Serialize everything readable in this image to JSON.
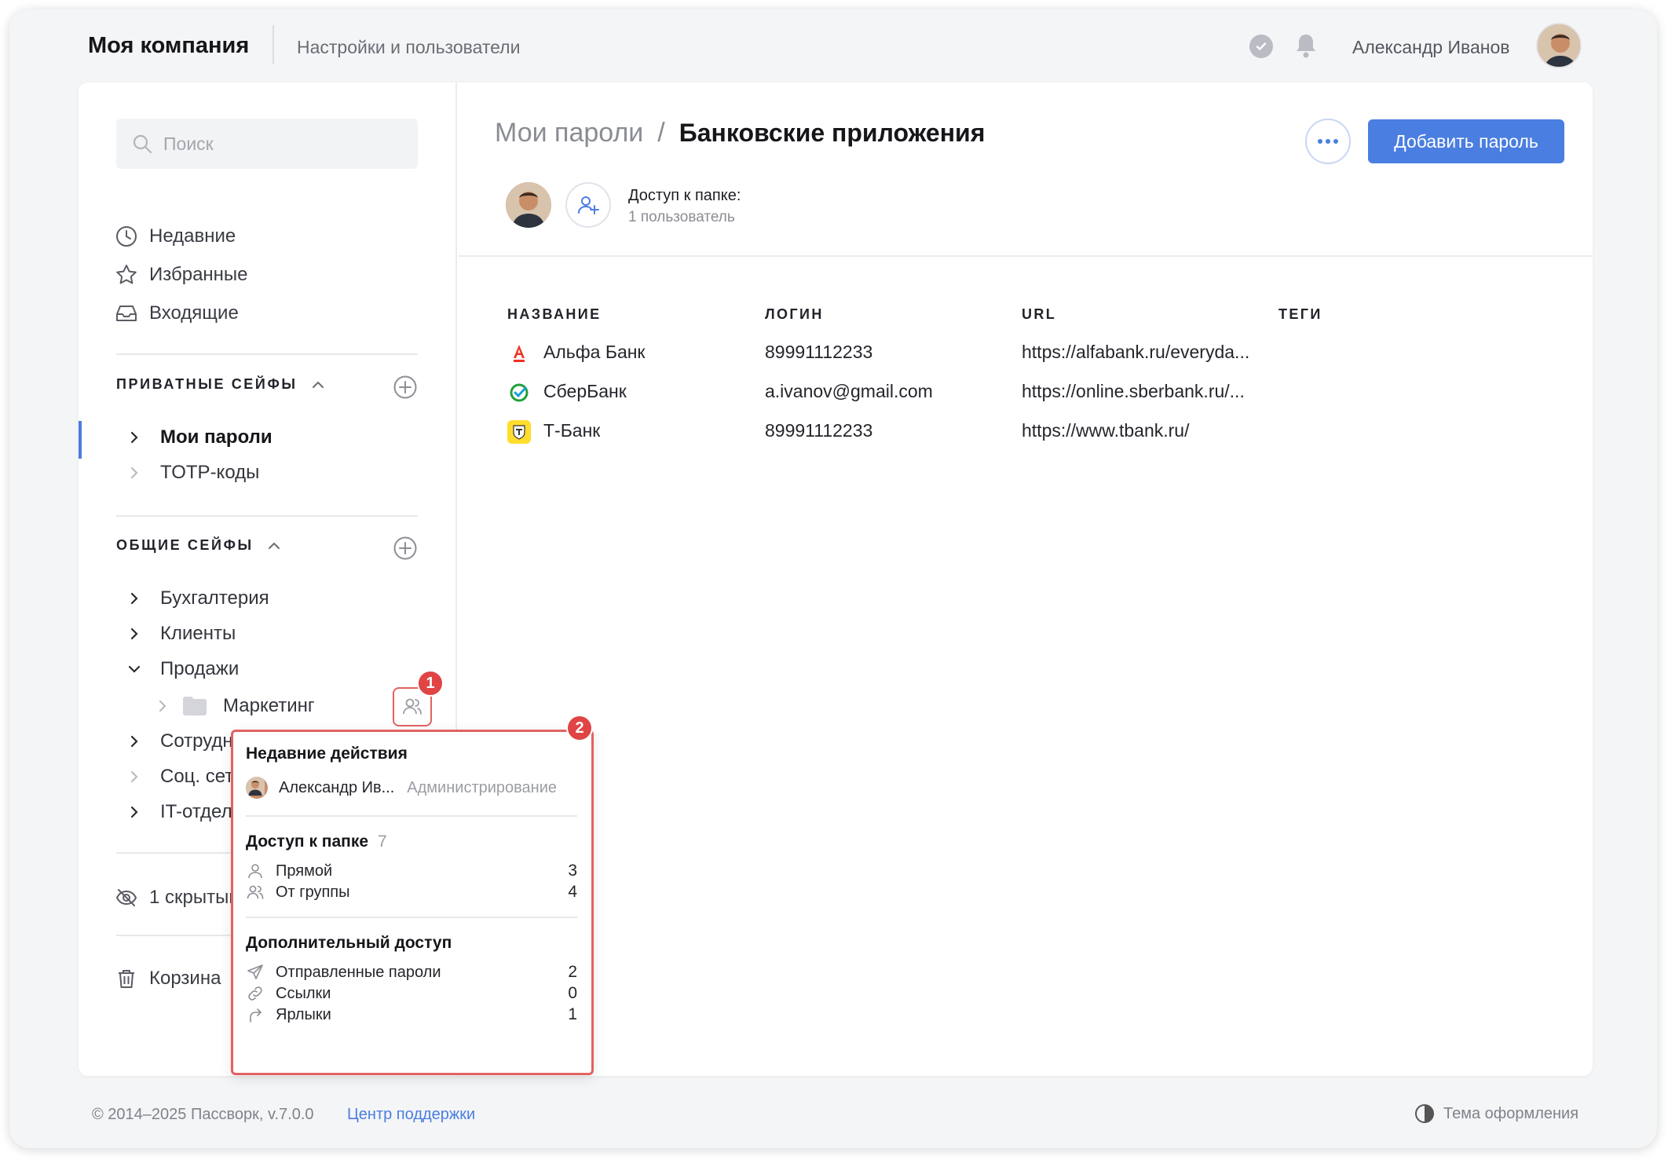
{
  "header": {
    "company": "Моя компания",
    "section": "Настройки и пользователи",
    "user_name": "Александр Иванов"
  },
  "sidebar": {
    "search_placeholder": "Поиск",
    "nav": [
      {
        "label": "Недавние",
        "icon": "clock-icon"
      },
      {
        "label": "Избранные",
        "icon": "star-icon"
      },
      {
        "label": "Входящие",
        "icon": "inbox-icon"
      }
    ],
    "private_vaults": {
      "title": "ПРИВАТНЫЕ СЕЙФЫ",
      "items": [
        {
          "label": "Мои пароли",
          "active": true
        },
        {
          "label": "TOTP-коды"
        }
      ]
    },
    "shared_vaults": {
      "title": "ОБЩИЕ СЕЙФЫ",
      "items": [
        {
          "label": "Бухгалтерия"
        },
        {
          "label": "Клиенты"
        },
        {
          "label": "Продажи",
          "expanded": true
        },
        {
          "label": "Маркетинг",
          "nested": true
        },
        {
          "label": "Сотрудники"
        },
        {
          "label": "Соц. сети"
        },
        {
          "label": "IT-отдел"
        }
      ]
    },
    "hidden": "1 скрытый",
    "trash": "Корзина"
  },
  "content": {
    "breadcrumb_parent": "Мои пароли",
    "breadcrumb_separator": "/",
    "breadcrumb_current": "Банковские приложения",
    "add_button": "Добавить пароль",
    "access_title": "Доступ к папке:",
    "access_sub": "1 пользователь",
    "columns": [
      "НАЗВАНИЕ",
      "ЛОГИН",
      "URL",
      "ТЕГИ"
    ],
    "rows": [
      {
        "name": "Альфа Банк",
        "login": "89991112233",
        "url": "https://alfabank.ru/everyda...",
        "icon": "alfa-bank-icon",
        "color": "#ef3124"
      },
      {
        "name": "СберБанк",
        "login": "a.ivanov@gmail.com",
        "url": "https://online.sberbank.ru/...",
        "icon": "sberbank-icon",
        "color": "#21a038"
      },
      {
        "name": "Т-Банк",
        "login": "89991112233",
        "url": "https://www.tbank.ru/",
        "icon": "tbank-icon",
        "color": "#ffdd2d"
      }
    ]
  },
  "popup": {
    "recent_title": "Недавние действия",
    "recent_user": "Александр Ив...",
    "recent_action": "Администрирование",
    "access_title": "Доступ к папке",
    "access_total": "7",
    "direct_label": "Прямой",
    "direct_count": "3",
    "group_label": "От группы",
    "group_count": "4",
    "extra_title": "Дополнительный доступ",
    "sent_label": "Отправленные пароли",
    "sent_count": "2",
    "links_label": "Ссылки",
    "links_count": "0",
    "shortcuts_label": "Ярлыки",
    "shortcuts_count": "1"
  },
  "badges": {
    "one": "1",
    "two": "2"
  },
  "footer": {
    "copyright": "© 2014–2025 Пассворк, v.7.0.0",
    "support": "Центр поддержки",
    "theme": "Тема оформления"
  },
  "colors": {
    "accent": "#4a7ee0",
    "highlight": "#e26262",
    "badge": "#e04444"
  }
}
